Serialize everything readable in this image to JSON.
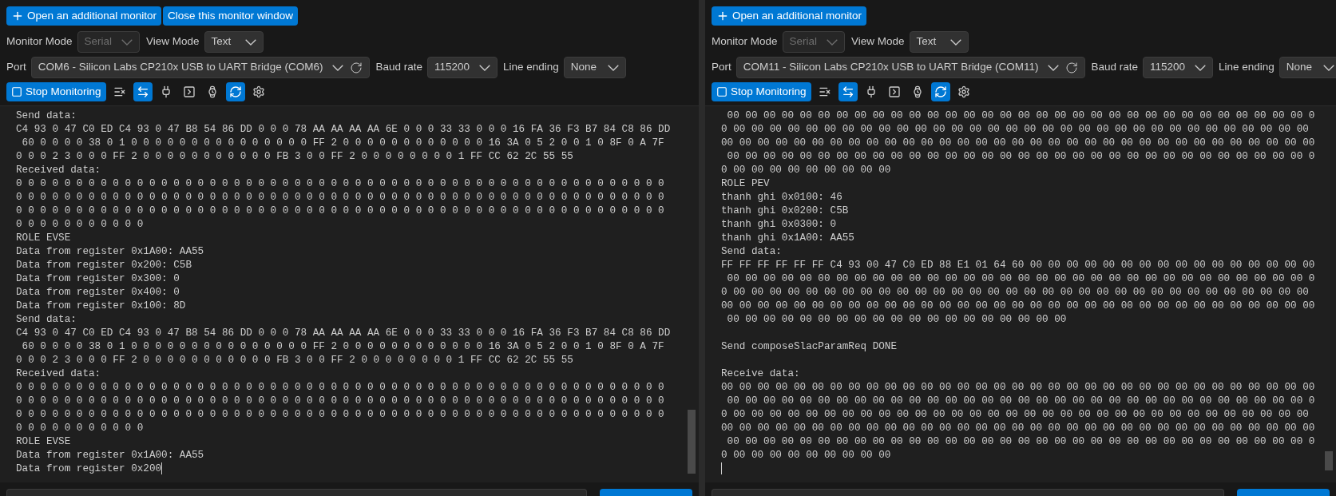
{
  "monitors": [
    {
      "buttons": [
        {
          "label": "Open an additional monitor",
          "kind": "add"
        },
        {
          "label": "Close this monitor window",
          "kind": "plain"
        }
      ],
      "monitor_mode": {
        "label": "Monitor Mode",
        "value": "Serial",
        "disabled": true
      },
      "view_mode": {
        "label": "View Mode",
        "value": "Text",
        "disabled": false
      },
      "port": {
        "label": "Port",
        "value": "COM6 - Silicon Labs CP210x USB to UART Bridge (COM6)",
        "disabled": false
      },
      "baud_rate": {
        "label": "Baud rate",
        "value": "115200",
        "disabled": false
      },
      "line_ending": {
        "label": "Line ending",
        "value": "None",
        "disabled": false
      },
      "stop_button": "Stop Monitoring",
      "tools": [
        {
          "kind": "clear",
          "on": false
        },
        {
          "kind": "swap",
          "on": true
        },
        {
          "kind": "plug",
          "on": false
        },
        {
          "kind": "terminal",
          "on": false
        },
        {
          "kind": "watch",
          "on": false
        },
        {
          "kind": "refresh",
          "on": true
        },
        {
          "kind": "settings",
          "on": false
        }
      ],
      "cursor_on_new_line": false,
      "output_blocks": [
        [
          "Send data:",
          "C4 93 0 47 C0 ED C4 93 0 47 B8 54 86 DD 0 0 0 78 AA AA AA AA 6E 0 0 0 33 33 0 0 0 16 FA 36 F3 B7 84 C8 86 DD",
          " 60 0 0 0 0 38 0 1 0 0 0 0 0 0 0 0 0 0 0 0 0 0 0 FF 2 0 0 0 0 0 0 0 0 0 0 0 0 16 3A 0 5 2 0 0 1 0 8F 0 A 7F",
          "0 0 0 2 3 0 0 0 FF 2 0 0 0 0 0 0 0 0 0 0 0 FB 3 0 0 FF 2 0 0 0 0 0 0 0 0 1 FF CC 62 2C 55 55",
          "Received data:",
          "0 0 0 0 0 0 0 0 0 0 0 0 0 0 0 0 0 0 0 0 0 0 0 0 0 0 0 0 0 0 0 0 0 0 0 0 0 0 0 0 0 0 0 0 0 0 0 0 0 0 0 0 0 0",
          "0 0 0 0 0 0 0 0 0 0 0 0 0 0 0 0 0 0 0 0 0 0 0 0 0 0 0 0 0 0 0 0 0 0 0 0 0 0 0 0 0 0 0 0 0 0 0 0 0 0 0 0 0 0",
          "0 0 0 0 0 0 0 0 0 0 0 0 0 0 0 0 0 0 0 0 0 0 0 0 0 0 0 0 0 0 0 0 0 0 0 0 0 0 0 0 0 0 0 0 0 0 0 0 0 0 0 0 0 0",
          "0 0 0 0 0 0 0 0 0 0 0",
          "ROLE EVSE",
          "Data from register 0x1A00: AA55",
          "Data from register 0x200: C5B",
          "Data from register 0x300: 0",
          "Data from register 0x400: 0",
          "Data from register 0x100: 8D",
          "Send data:",
          "C4 93 0 47 C0 ED C4 93 0 47 B8 54 86 DD 0 0 0 78 AA AA AA AA 6E 0 0 0 33 33 0 0 0 16 FA 36 F3 B7 84 C8 86 DD",
          " 60 0 0 0 0 38 0 1 0 0 0 0 0 0 0 0 0 0 0 0 0 0 0 FF 2 0 0 0 0 0 0 0 0 0 0 0 0 16 3A 0 5 2 0 0 1 0 8F 0 A 7F",
          "0 0 0 2 3 0 0 0 FF 2 0 0 0 0 0 0 0 0 0 0 0 FB 3 0 0 FF 2 0 0 0 0 0 0 0 0 1 FF CC 62 2C 55 55",
          "Received data:",
          "0 0 0 0 0 0 0 0 0 0 0 0 0 0 0 0 0 0 0 0 0 0 0 0 0 0 0 0 0 0 0 0 0 0 0 0 0 0 0 0 0 0 0 0 0 0 0 0 0 0 0 0 0 0",
          "0 0 0 0 0 0 0 0 0 0 0 0 0 0 0 0 0 0 0 0 0 0 0 0 0 0 0 0 0 0 0 0 0 0 0 0 0 0 0 0 0 0 0 0 0 0 0 0 0 0 0 0 0 0",
          "0 0 0 0 0 0 0 0 0 0 0 0 0 0 0 0 0 0 0 0 0 0 0 0 0 0 0 0 0 0 0 0 0 0 0 0 0 0 0 0 0 0 0 0 0 0 0 0 0 0 0 0 0 0",
          "0 0 0 0 0 0 0 0 0 0 0",
          "ROLE EVSE",
          "Data from register 0x1A00: AA55",
          "Data from register 0x200"
        ]
      ]
    },
    {
      "buttons": [
        {
          "label": "Open an additional monitor",
          "kind": "add"
        }
      ],
      "monitor_mode": {
        "label": "Monitor Mode",
        "value": "Serial",
        "disabled": true
      },
      "view_mode": {
        "label": "View Mode",
        "value": "Text",
        "disabled": false
      },
      "port": {
        "label": "Port",
        "value": "COM11 - Silicon Labs CP210x USB to UART Bridge (COM11)",
        "disabled": false
      },
      "baud_rate": {
        "label": "Baud rate",
        "value": "115200",
        "disabled": false
      },
      "line_ending": {
        "label": "Line ending",
        "value": "None",
        "disabled": false
      },
      "stop_button": "Stop Monitoring",
      "tools": [
        {
          "kind": "clear",
          "on": false
        },
        {
          "kind": "swap",
          "on": true
        },
        {
          "kind": "plug",
          "on": false
        },
        {
          "kind": "terminal",
          "on": false
        },
        {
          "kind": "watch",
          "on": false
        },
        {
          "kind": "refresh",
          "on": true
        },
        {
          "kind": "settings",
          "on": false
        }
      ],
      "cursor_on_new_line": true,
      "output_blocks": [
        [
          " 00 00 00 00 00 00 00 00 00 00 00 00 00 00 00 00 00 00 00 00 00 00 00 00 00 00 00 00 00 00 00 00 0",
          "0 00 00 00 00 00 00 00 00 00 00 00 00 00 00 00 00 00 00 00 00 00 00 00 00 00 00 00 00 00 00 00 00",
          "00 00 00 00 00 00 00 00 00 00 00 00 00 00 00 00 00 00 00 00 00 00 00 00 00 00 00 00 00 00 00 00 00",
          " 00 00 00 00 00 00 00 00 00 00 00 00 00 00 00 00 00 00 00 00 00 00 00 00 00 00 00 00 00 00 00 00 0",
          "0 00 00 00 00 00 00 00 00 00",
          "ROLE PEV",
          "thanh ghi 0x0100: 46",
          "thanh ghi 0x0200: C5B",
          "thanh ghi 0x0300: 0",
          "thanh ghi 0x1A00: AA55",
          "Send data:",
          "FF FF FF FF FF FF C4 93 00 47 C0 ED 88 E1 01 64 60 00 00 00 00 00 00 00 00 00 00 00 00 00 00 00 00",
          " 00 00 00 00 00 00 00 00 00 00 00 00 00 00 00 00 00 00 00 00 00 00 00 00 00 00 00 00 00 00 00 00 0",
          "0 00 00 00 00 00 00 00 00 00 00 00 00 00 00 00 00 00 00 00 00 00 00 00 00 00 00 00 00 00 00 00 00",
          "00 00 00 00 00 00 00 00 00 00 00 00 00 00 00 00 00 00 00 00 00 00 00 00 00 00 00 00 00 00 00 00 00",
          " 00 00 00 00 00 00 00 00 00 00 00 00 00 00 00 00 00 00 00"
        ],
        [
          "Send composeSlacParamReq DONE"
        ],
        [
          "Receive data:",
          "00 00 00 00 00 00 00 00 00 00 00 00 00 00 00 00 00 00 00 00 00 00 00 00 00 00 00 00 00 00 00 00 00",
          " 00 00 00 00 00 00 00 00 00 00 00 00 00 00 00 00 00 00 00 00 00 00 00 00 00 00 00 00 00 00 00 00 0",
          "0 00 00 00 00 00 00 00 00 00 00 00 00 00 00 00 00 00 00 00 00 00 00 00 00 00 00 00 00 00 00 00 00",
          "00 00 00 00 00 00 00 00 00 00 00 00 00 00 00 00 00 00 00 00 00 00 00 00 00 00 00 00 00 00 00 00 00",
          " 00 00 00 00 00 00 00 00 00 00 00 00 00 00 00 00 00 00 00 00 00 00 00 00 00 00 00 00 00 00 00 00 0",
          "0 00 00 00 00 00 00 00 00 00"
        ]
      ]
    }
  ]
}
